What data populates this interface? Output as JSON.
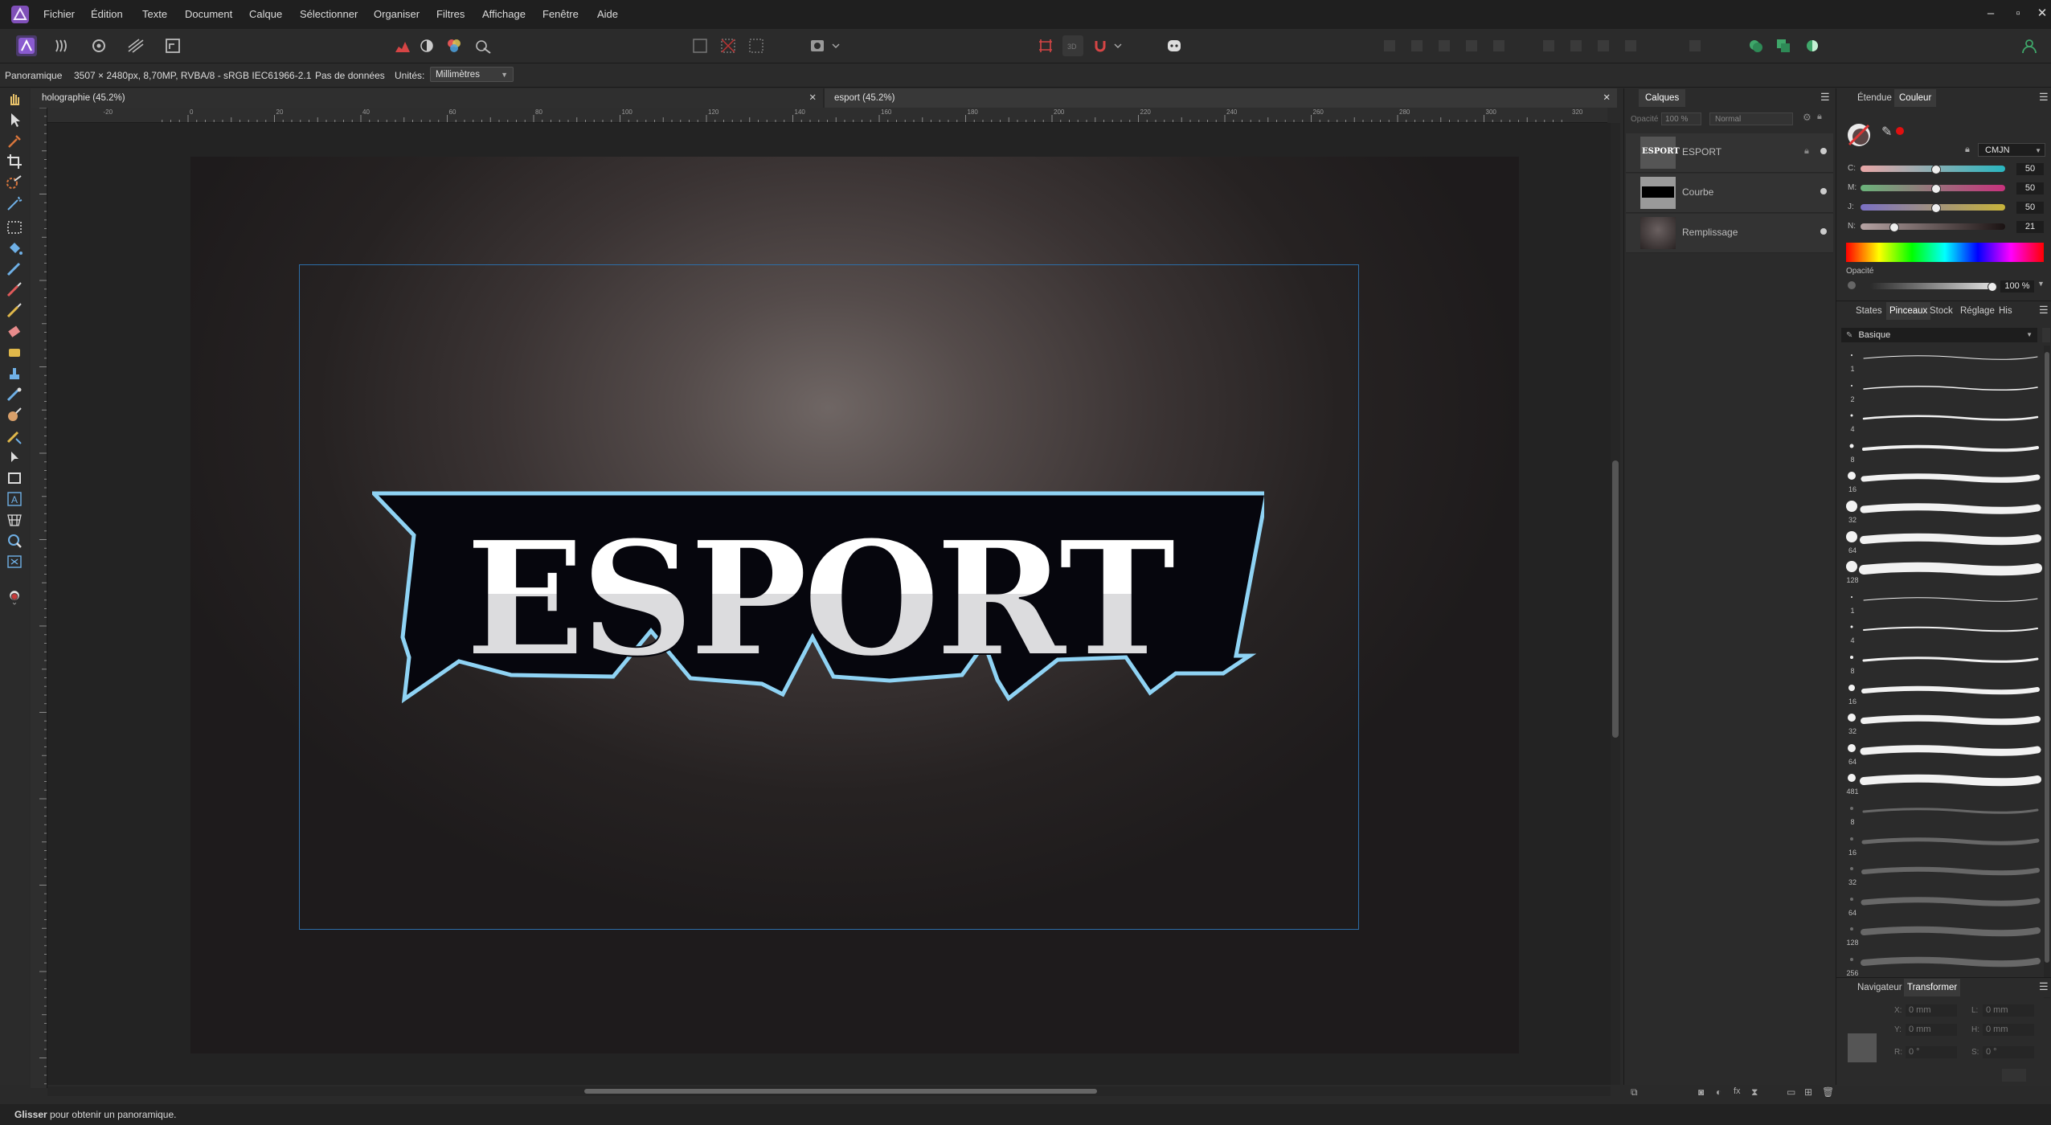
{
  "menu": {
    "items": [
      "Fichier",
      "Édition",
      "Texte",
      "Document",
      "Calque",
      "Sélectionner",
      "Organiser",
      "Filtres",
      "Affichage",
      "Fenêtre",
      "Aide"
    ]
  },
  "context": {
    "tool": "Panoramique",
    "doc_info": "3507 × 2480px, 8,70MP, RVBA/8 - sRGB IEC61966-2.1",
    "metadata": "Pas de données",
    "units_label": "Unités:",
    "units_value": "Millimètres"
  },
  "tabs": [
    {
      "label": "holographie (45.2%)"
    },
    {
      "label": "esport (45.2%)"
    }
  ],
  "ruler_labels": [
    "-20",
    "0",
    "20",
    "40",
    "60",
    "80",
    "100",
    "120",
    "140",
    "160",
    "180",
    "200",
    "220",
    "240",
    "260",
    "280",
    "300",
    "320"
  ],
  "artwork": {
    "text": "ESPORT"
  },
  "layers": {
    "tab": "Calques",
    "opacity_label": "Opacité",
    "opacity_value": "100 %",
    "blend_mode": "Normal",
    "items": [
      {
        "name": "ESPORT",
        "thumb": "ESPORT"
      },
      {
        "name": "Courbe"
      },
      {
        "name": "Remplissage"
      }
    ]
  },
  "color_panel": {
    "tabs": [
      "Étendue",
      "Couleur"
    ],
    "active": "Couleur",
    "model": "CMJN",
    "channels": [
      {
        "label": "C:",
        "value": "50"
      },
      {
        "label": "M:",
        "value": "50"
      },
      {
        "label": "J:",
        "value": "50"
      },
      {
        "label": "N:",
        "value": "21"
      }
    ],
    "opacity_label": "Opacité",
    "opacity_value": "100 %"
  },
  "brushes_panel": {
    "tabs": [
      "States",
      "Pinceaux",
      "Stock",
      "Réglage",
      "His"
    ],
    "active": "Pinceaux",
    "category": "Basique",
    "sizes": [
      "1",
      "2",
      "4",
      "8",
      "16",
      "32",
      "64",
      "128",
      "1",
      "4",
      "8",
      "16",
      "32",
      "64",
      "481",
      "8",
      "16",
      "32",
      "64",
      "128",
      "256"
    ]
  },
  "transform_panel": {
    "tabs": [
      "Navigateur",
      "Transformer"
    ],
    "active": "Transformer",
    "fields": [
      {
        "label": "X:",
        "value": "0 mm"
      },
      {
        "label": "L:",
        "value": "0 mm"
      },
      {
        "label": "Y:",
        "value": "0 mm"
      },
      {
        "label": "H:",
        "value": "0 mm"
      },
      {
        "label": "R:",
        "value": "0 °"
      },
      {
        "label": "S:",
        "value": "0 °"
      }
    ]
  },
  "status": {
    "bold": "Glisser",
    "text": " pour obtenir un panoramique."
  },
  "colors": {
    "accent_blue": "#8fd3f4",
    "guide": "#2d6ea8",
    "letter_white": "#ffffff",
    "letter_grey": "#dedee0",
    "outline_dark": "#06060d"
  }
}
